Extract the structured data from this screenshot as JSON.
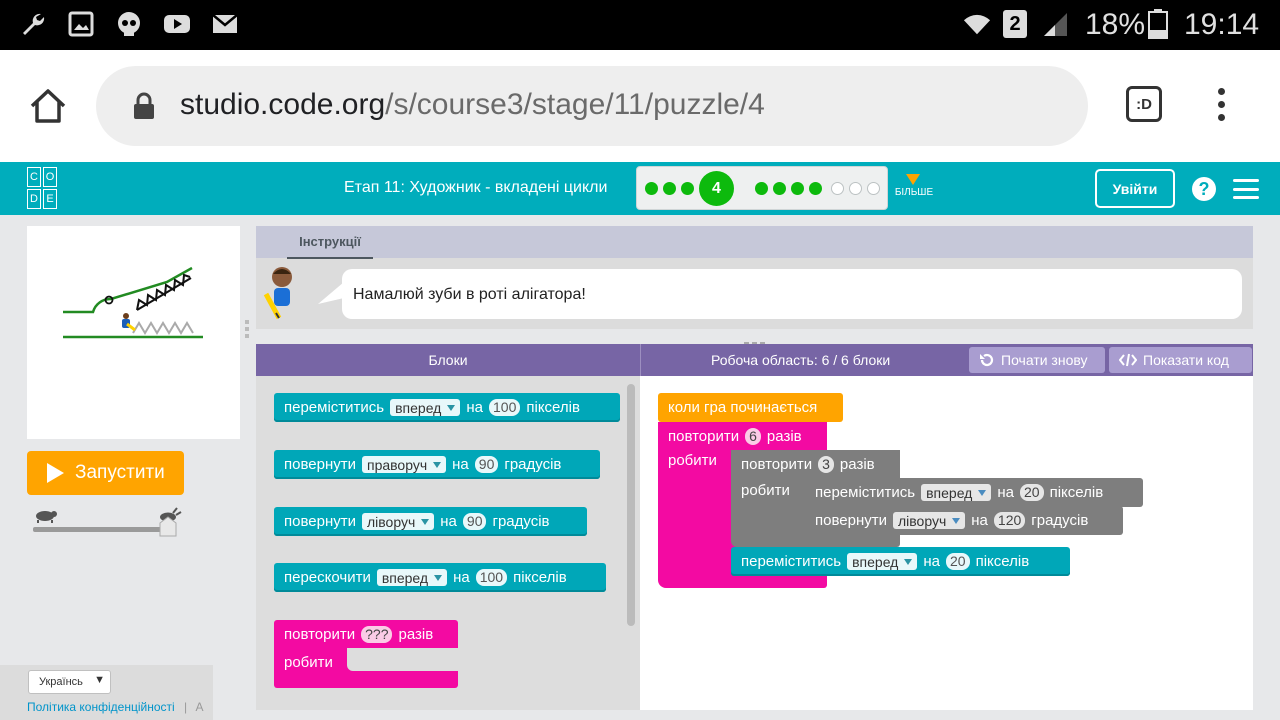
{
  "status": {
    "battery": "18%",
    "time": "19:14",
    "sim": "2"
  },
  "browser": {
    "url_domain": "studio.code.org",
    "url_path": "/s/course3/stage/11/puzzle/4"
  },
  "header": {
    "logo": [
      "C",
      "O",
      "D",
      "E"
    ],
    "stage_title": "Етап 11: Художник - вкладені цикли",
    "current_puzzle": "4",
    "more": "БІЛЬШЕ",
    "signin": "Увійти",
    "help": "?"
  },
  "left": {
    "run": "Запустити",
    "language": "Українсь",
    "privacy": "Політика конфіденційності",
    "separator": "|",
    "more_link": "A"
  },
  "instructions": {
    "tab": "Інструкції",
    "text": "Намалюй зуби в роті алігатора!"
  },
  "ws_header": {
    "toolbox": "Блоки",
    "workspace": "Робоча область: 6 / 6 блоки",
    "reset": "Почати знову",
    "show_code": "Показати код"
  },
  "toolbox": {
    "b1": {
      "a": "переміститись",
      "dd": "вперед",
      "b": "на",
      "val": "100",
      "c": "пікселів"
    },
    "b2": {
      "a": "повернути",
      "dd": "праворуч",
      "b": "на",
      "val": "90",
      "c": "градусів"
    },
    "b3": {
      "a": "повернути",
      "dd": "ліворуч",
      "b": "на",
      "val": "90",
      "c": "градусів"
    },
    "b4": {
      "a": "перескочити",
      "dd": "вперед",
      "b": "на",
      "val": "100",
      "c": "пікселів"
    },
    "b5": {
      "a": "повторити",
      "val": "???",
      "c": "разів",
      "do": "робити"
    }
  },
  "program": {
    "hat": "коли гра починається",
    "rep1": {
      "a": "повторити",
      "val": "6",
      "c": "разів",
      "do": "робити"
    },
    "rep2": {
      "a": "повторити",
      "val": "3",
      "c": "разів",
      "do": "робити"
    },
    "mv1": {
      "a": "переміститись",
      "dd": "вперед",
      "b": "на",
      "val": "20",
      "c": "пікселів"
    },
    "tr1": {
      "a": "повернути",
      "dd": "ліворуч",
      "b": "на",
      "val": "120",
      "c": "градусів"
    },
    "mv2": {
      "a": "переміститись",
      "dd": "вперед",
      "b": "на",
      "val": "20",
      "c": "пікселів"
    }
  },
  "colors": {
    "header": "#00adbc",
    "motion": "#00a7b8",
    "loop": "#f30aa2",
    "event": "#ffa400",
    "run": "#ffa400",
    "progress_done": "#0dba0d"
  }
}
